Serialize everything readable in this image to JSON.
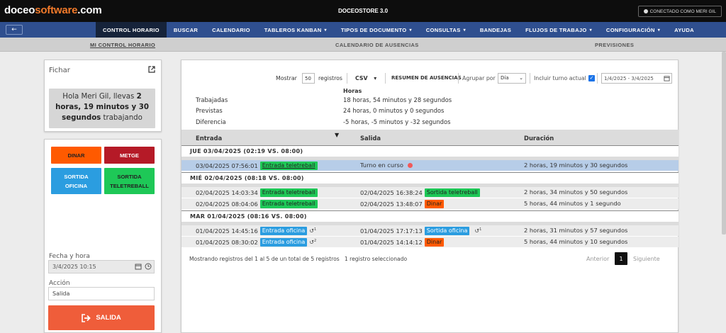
{
  "topbar": {
    "logo_part1": "doceo",
    "logo_part2": "software",
    "logo_part3": ".com",
    "app_name": "DOCEOSTORE 3.0",
    "user_button": "CONECTADO COMO MERI GIL"
  },
  "nav": {
    "back_icon": "arrow-left-icon",
    "items": [
      {
        "label": "CONTROL HORARIO",
        "active": true,
        "dropdown": false
      },
      {
        "label": "BUSCAR",
        "active": false,
        "dropdown": false
      },
      {
        "label": "CALENDARIO",
        "active": false,
        "dropdown": false
      },
      {
        "label": "TABLEROS KANBAN",
        "active": false,
        "dropdown": true
      },
      {
        "label": "TIPOS DE DOCUMENTO",
        "active": false,
        "dropdown": true
      },
      {
        "label": "CONSULTAS",
        "active": false,
        "dropdown": true
      },
      {
        "label": "BANDEJAS",
        "active": false,
        "dropdown": false
      },
      {
        "label": "FLUJOS DE TRABAJO",
        "active": false,
        "dropdown": true
      },
      {
        "label": "CONFIGURACIÓN",
        "active": false,
        "dropdown": true
      },
      {
        "label": "AYUDA",
        "active": false,
        "dropdown": false
      }
    ]
  },
  "subnav": {
    "items": [
      "MI CONTROL HORARIO",
      "CALENDARIO DE AUSENCIAS",
      "PREVISIONES"
    ]
  },
  "fichar": {
    "title": "Fichar",
    "greeting_pre": "Hola Meri Gil, llevas ",
    "greeting_time": "2 horas, 19 minutos y 30 segundos",
    "greeting_post": " trabajando"
  },
  "actions": {
    "dinar": "DINAR",
    "metge": "METGE",
    "sortida_oficina_1": "SORTIDA",
    "sortida_oficina_2": "OFICINA",
    "sortida_tele_1": "SORTIDA",
    "sortida_tele_2": "TELETREBALL",
    "fecha_label": "Fecha y hora",
    "fecha_value": "3/4/2025 10:15",
    "accion_label": "Acción",
    "accion_value": "Salida",
    "salida_button": "SALIDA"
  },
  "toolbar": {
    "mostrar": "Mostrar",
    "per_page": "50",
    "registros": "registros",
    "csv": "CSV",
    "resumen": "RESUMEN DE AUSENCIAS",
    "agrupar": "Agrupar por",
    "agrupar_value": "Día",
    "incluir": "Incluir turno actual",
    "date_range": "1/4/2025 - 3/4/2025"
  },
  "summary": {
    "header": "Horas",
    "rows": [
      {
        "label": "Trabajadas",
        "value": "18 horas, 54 minutos y 28 segundos"
      },
      {
        "label": "Previstas",
        "value": "24 horas, 0 minutos y 0 segundos"
      },
      {
        "label": "Diferencia",
        "value": "-5 horas, -5 minutos y -32 segundos"
      }
    ]
  },
  "table": {
    "columns": [
      "Entrada",
      "Salida",
      "Duración"
    ],
    "groups": [
      {
        "title": "JUE 03/04/2025 (02:19 VS. 08:00)",
        "rows": [
          {
            "in_time": "03/04/2025 07:56:01",
            "in_badge": "Entrada teletreball",
            "out_time": "Turno en curso",
            "out_badge": "",
            "duration": "2 horas, 19 minutos y 30 segundos",
            "selected": true
          }
        ]
      },
      {
        "title": "MIÉ 02/04/2025 (08:18 VS. 08:00)",
        "rows": [
          {
            "in_time": "02/04/2025 14:03:34",
            "in_badge": "Entrada teletreball",
            "out_time": "02/04/2025 16:38:24",
            "out_badge": "Sortida teletreball",
            "duration": "2 horas, 34 minutos y 50 segundos"
          },
          {
            "in_time": "02/04/2025 08:04:06",
            "in_badge": "Entrada teletreball",
            "out_time": "02/04/2025 13:48:07",
            "out_badge": "Dinar",
            "duration": "5 horas, 44 minutos y 1 segundo"
          }
        ]
      },
      {
        "title": "MAR 01/04/2025 (08:16 VS. 08:00)",
        "rows": [
          {
            "in_time": "01/04/2025 14:45:16",
            "in_badge": "Entrada oficina",
            "in_hist": "1",
            "out_time": "01/04/2025 17:17:13",
            "out_badge": "Sortida oficina",
            "out_hist": "1",
            "duration": "2 horas, 31 minutos y 57 segundos"
          },
          {
            "in_time": "01/04/2025 08:30:02",
            "in_badge": "Entrada oficina",
            "in_hist": "2",
            "out_time": "01/04/2025 14:14:12",
            "out_badge": "Dinar",
            "duration": "5 horas, 44 minutos y 10 segundos"
          }
        ]
      }
    ]
  },
  "footer": {
    "info": "Mostrando registros del 1 al 5 de un total de 5 registros",
    "selected": "1 registro seleccionado",
    "prev": "Anterior",
    "page": "1",
    "next": "Siguiente"
  },
  "colors": {
    "navbar": "#2f4f8f",
    "nav_active": "#16233a",
    "logo_accent": "#f27a2a",
    "green": "#1ec857",
    "blue": "#2b9de0",
    "orange": "#ff5a00",
    "red": "#b51a27",
    "salida": "#ef5d3a"
  }
}
